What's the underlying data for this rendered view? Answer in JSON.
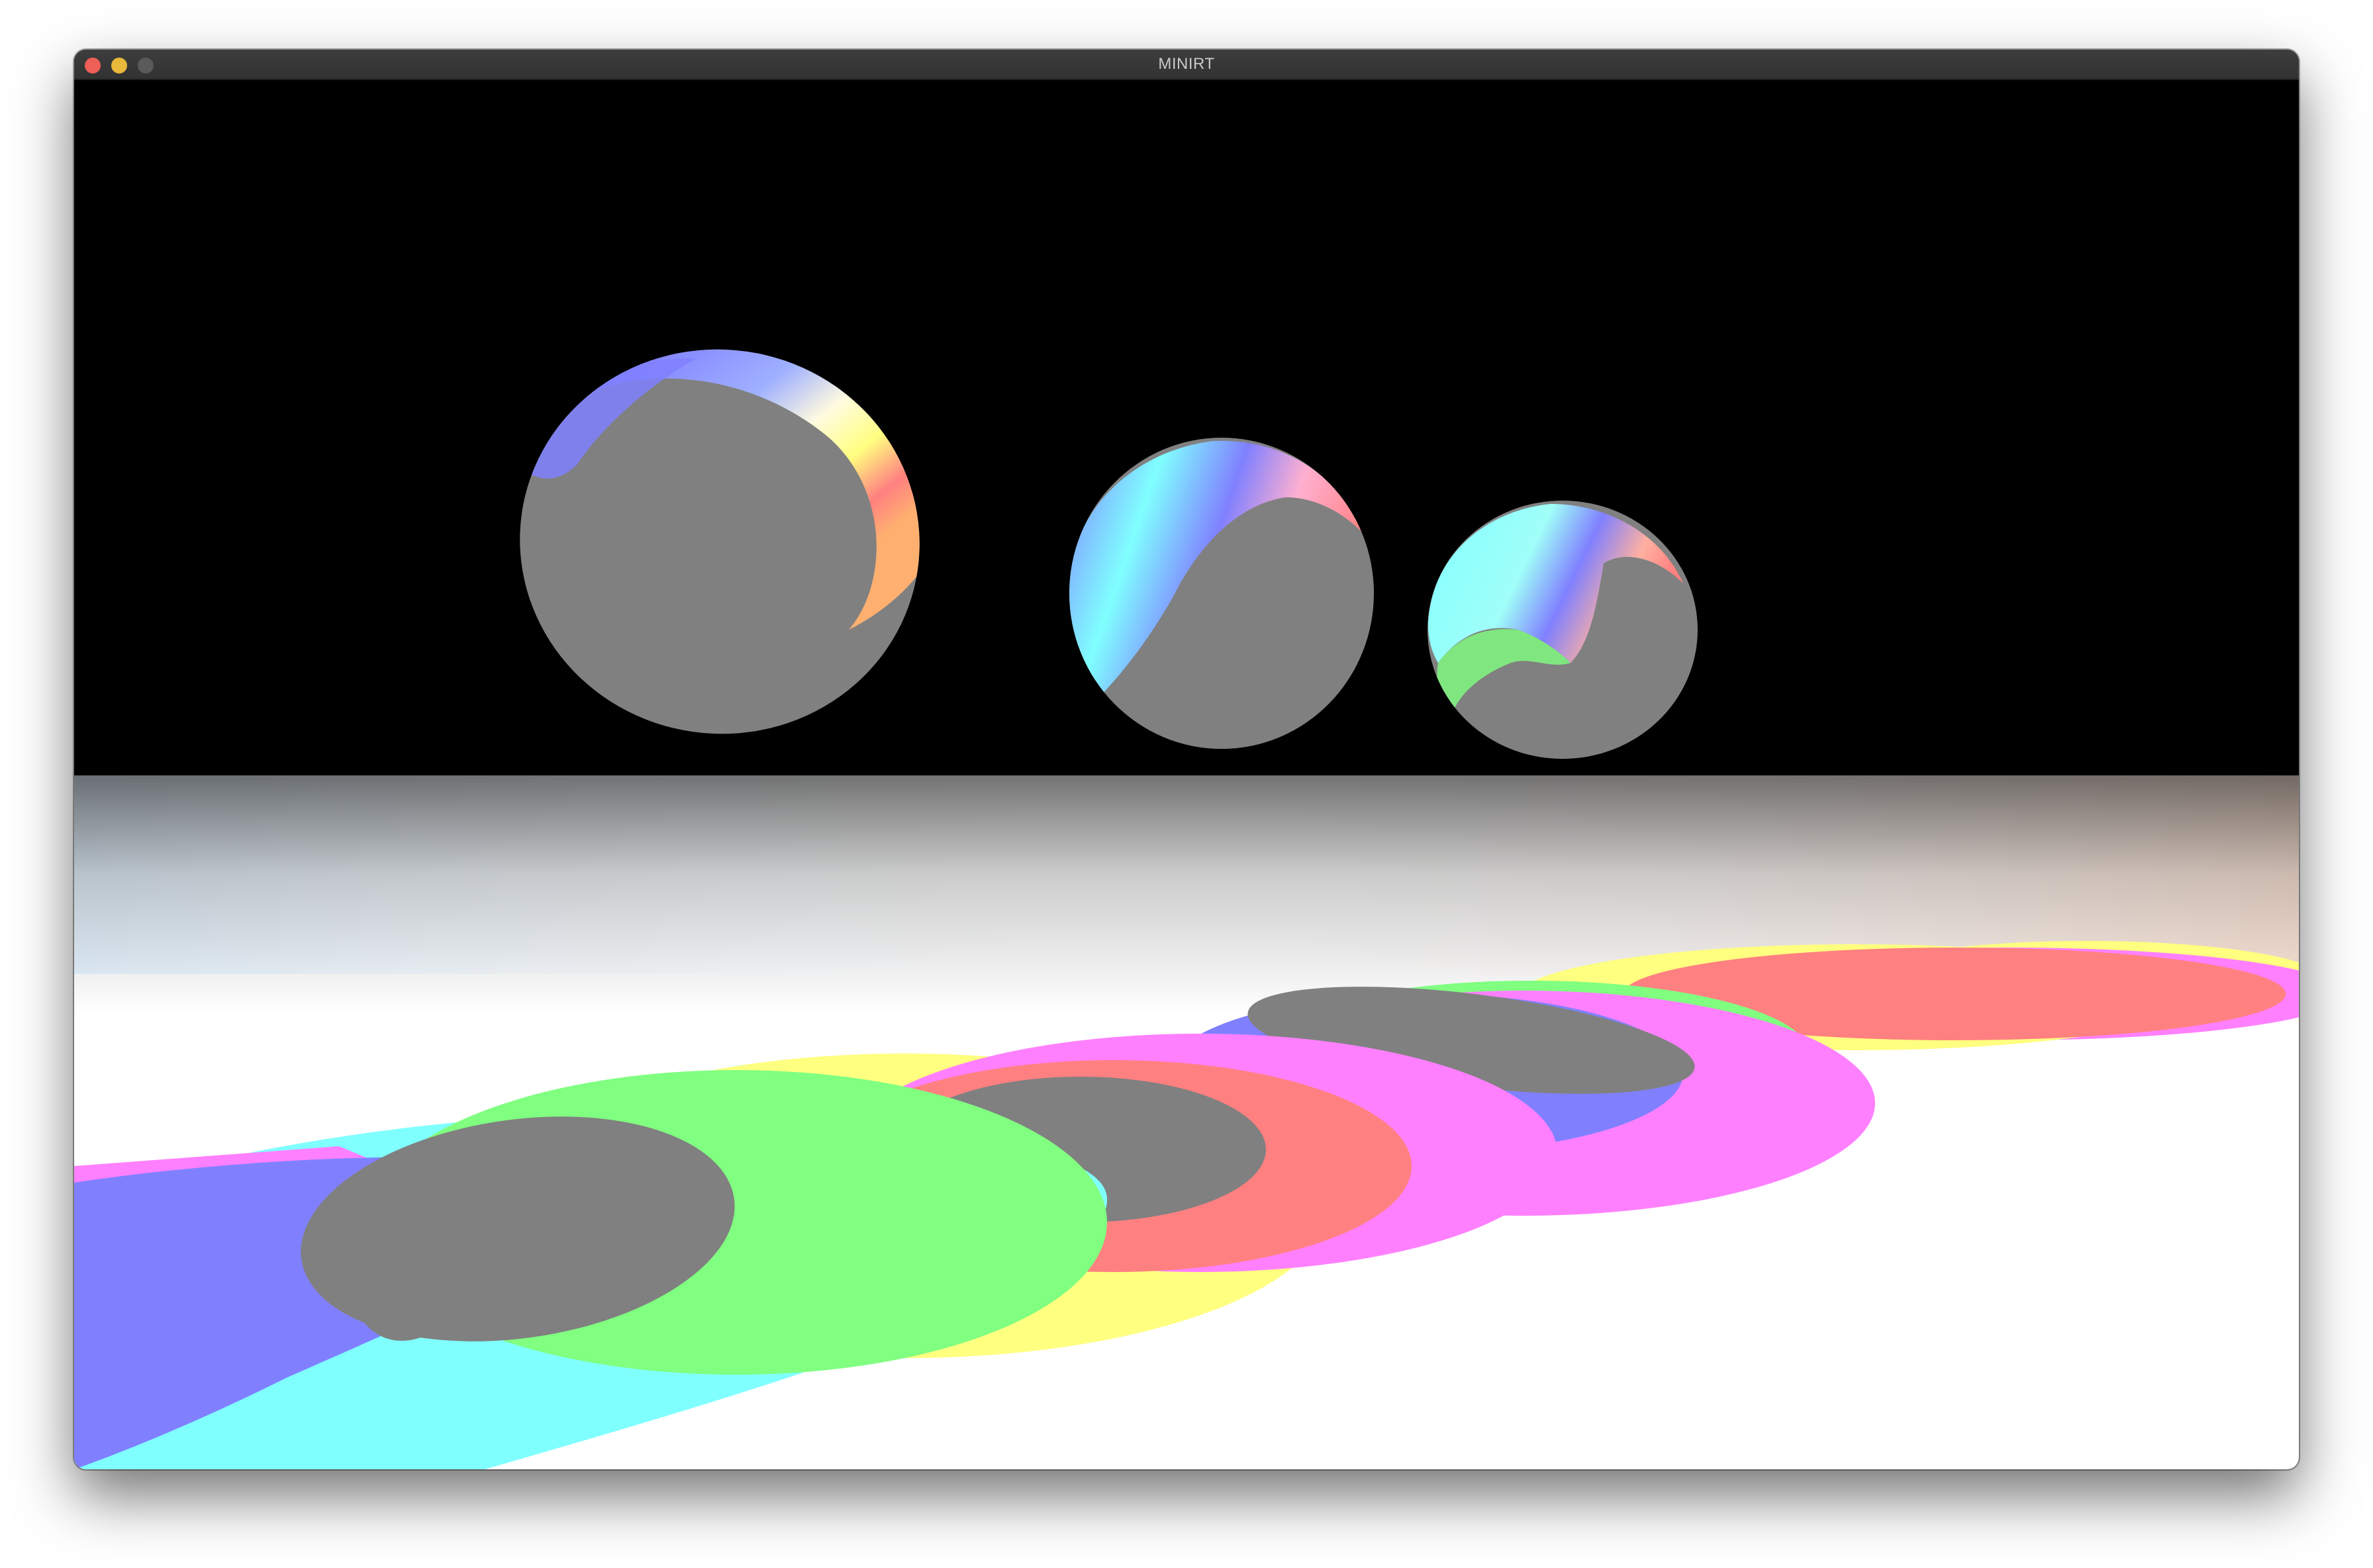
{
  "window": {
    "title": "MINIRT",
    "controls": {
      "close_color": "#ed5f57",
      "minimize_color": "#e9b93c",
      "maximize_color": "#5a5a5a"
    }
  },
  "scene": {
    "background_color": "#000000",
    "floor_color": "#ffffff",
    "object_base_color": "#808080",
    "light_colors": [
      "#ff0000",
      "#00ff00",
      "#0000ff"
    ],
    "shadow_colors": [
      "#8080ff",
      "#80ff80",
      "#ff8080",
      "#80ffff",
      "#ff80ff",
      "#ffff80",
      "#808080"
    ]
  }
}
